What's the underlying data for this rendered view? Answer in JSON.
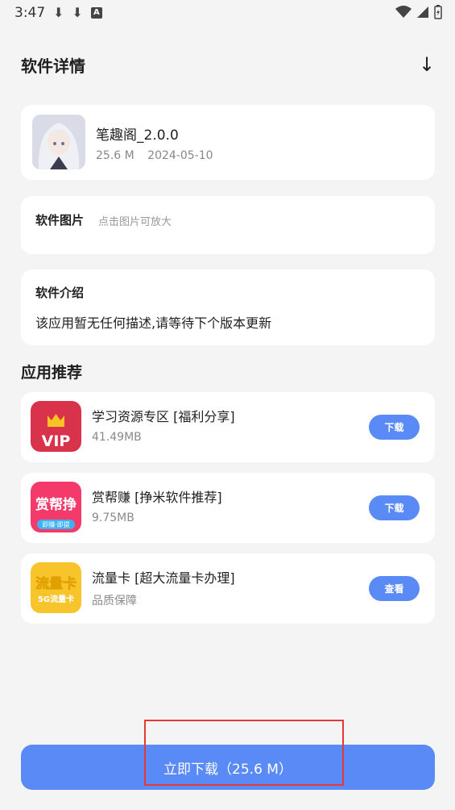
{
  "status": {
    "time": "3:47",
    "a_label": "A"
  },
  "header": {
    "title": "软件详情"
  },
  "app": {
    "name": "笔趣阁_2.0.0",
    "size": "25.6 M",
    "date": "2024-05-10"
  },
  "screenshots": {
    "title": "软件图片",
    "hint": "点击图片可放大"
  },
  "intro": {
    "title": "软件介绍",
    "text": "该应用暂无任何描述,请等待下个版本更新"
  },
  "recommend": {
    "title": "应用推荐",
    "items": [
      {
        "name": "学习资源专区 [福利分享]",
        "sub": "41.49MB",
        "button": "下载",
        "icon_text": "VIP"
      },
      {
        "name": "赏帮赚 [挣米软件推荐]",
        "sub": "9.75MB",
        "button": "下载",
        "icon_text": "赏帮挣",
        "icon_sub": "即赚·即提"
      },
      {
        "name": "流量卡 [超大流量卡办理]",
        "sub": "品质保障",
        "button": "查看",
        "icon_text": "流量卡",
        "icon_sub": "5G流量卡"
      }
    ]
  },
  "download_button": "立即下载（25.6 M）",
  "colors": {
    "accent": "#5a8af6",
    "highlight": "#e53935"
  }
}
